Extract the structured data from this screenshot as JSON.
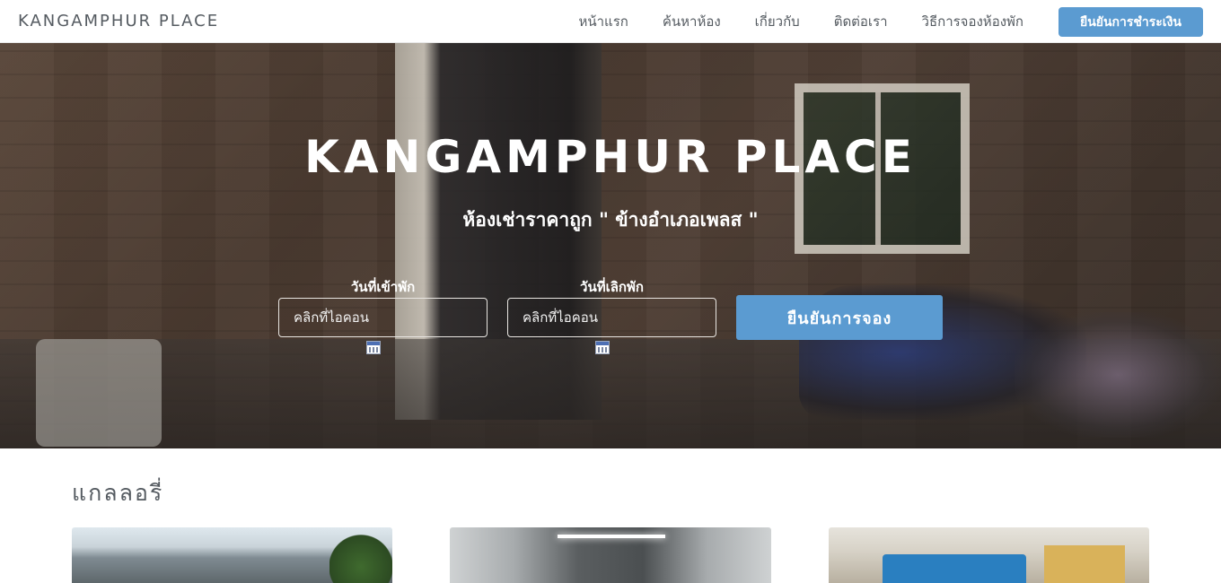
{
  "navbar": {
    "brand": "KANGAMPHUR PLACE",
    "links": [
      "หน้าแรก",
      "ค้นหาห้อง",
      "เกี่ยวกับ",
      "ติดต่อเรา",
      "วิธีการจองห้องพัก"
    ],
    "cta_label": "ยืนยันการชำระเงิน"
  },
  "hero": {
    "title": "KANGAMPHUR PLACE",
    "subtitle": "ห้องเช่าราคาถูก \" ข้างอำเภอเพลส \"",
    "checkin": {
      "label": "วันที่เข้าพัก",
      "placeholder": "คลิกที่ไอคอน",
      "icon": "calendar-icon"
    },
    "checkout": {
      "label": "วันที่เลิกพัก",
      "placeholder": "คลิกที่ไอคอน",
      "icon": "calendar-icon"
    },
    "confirm_label": "ยืนยันการจอง"
  },
  "gallery": {
    "title": "แกลลอรี่"
  },
  "colors": {
    "accent": "#5b9bd1",
    "nav_text": "#555b61"
  }
}
